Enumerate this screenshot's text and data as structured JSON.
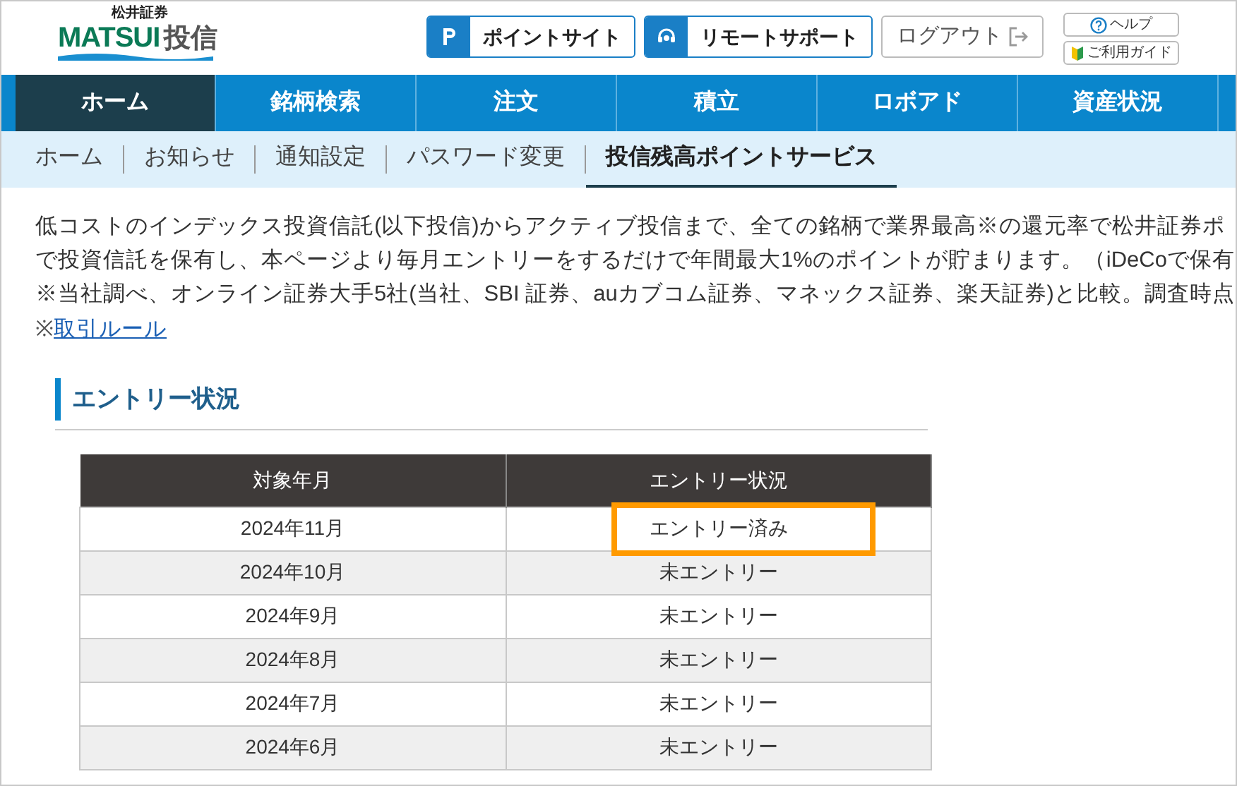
{
  "logo": {
    "company": "松井証券",
    "brand": "MATSUI",
    "product": "投信"
  },
  "header_buttons": [
    {
      "kind": "point",
      "label": "ポイントサイト"
    },
    {
      "kind": "support",
      "label": "リモートサポート"
    },
    {
      "kind": "logout",
      "label": "ログアウト"
    }
  ],
  "help_links": [
    {
      "kind": "help",
      "label": "ヘルプ"
    },
    {
      "kind": "guide",
      "label": "ご利用ガイド"
    }
  ],
  "nav_tabs": [
    {
      "label": "ホーム",
      "selected": true
    },
    {
      "label": "銘柄検索",
      "selected": false
    },
    {
      "label": "注文",
      "selected": false
    },
    {
      "label": "積立",
      "selected": false
    },
    {
      "label": "ロボアド",
      "selected": false
    },
    {
      "label": "資産状況",
      "selected": false
    }
  ],
  "sub_tabs": [
    {
      "label": "ホーム",
      "selected": false
    },
    {
      "label": "お知らせ",
      "selected": false
    },
    {
      "label": "通知設定",
      "selected": false
    },
    {
      "label": "パスワード変更",
      "selected": false
    },
    {
      "label": "投信残高ポイントサービス",
      "selected": true
    }
  ],
  "intro_lines": [
    "低コストのインデックス投資信託(以下投信)からアクティブ投信まで、全ての銘柄で業界最高※の還元率で松井証券ポ",
    "で投資信託を保有し、本ページより毎月エントリーをするだけで年間最大1%のポイントが貯まります。（iDeCoで保有",
    "※当社調べ、オンライン証券大手5社(当社、SBI 証券、auカブコム証券、マネックス証券、楽天証券)と比較。調査時点"
  ],
  "rules_link": {
    "prefix": "※",
    "label": "取引ルール"
  },
  "section_title": "エントリー状況",
  "table": {
    "columns": [
      "対象年月",
      "エントリー状況"
    ],
    "rows": [
      {
        "month": "2024年11月",
        "status": "エントリー済み",
        "highlighted": true
      },
      {
        "month": "2024年10月",
        "status": "未エントリー",
        "highlighted": false
      },
      {
        "month": "2024年9月",
        "status": "未エントリー",
        "highlighted": false
      },
      {
        "month": "2024年8月",
        "status": "未エントリー",
        "highlighted": false
      },
      {
        "month": "2024年7月",
        "status": "未エントリー",
        "highlighted": false
      },
      {
        "month": "2024年6月",
        "status": "未エントリー",
        "highlighted": false
      }
    ]
  }
}
